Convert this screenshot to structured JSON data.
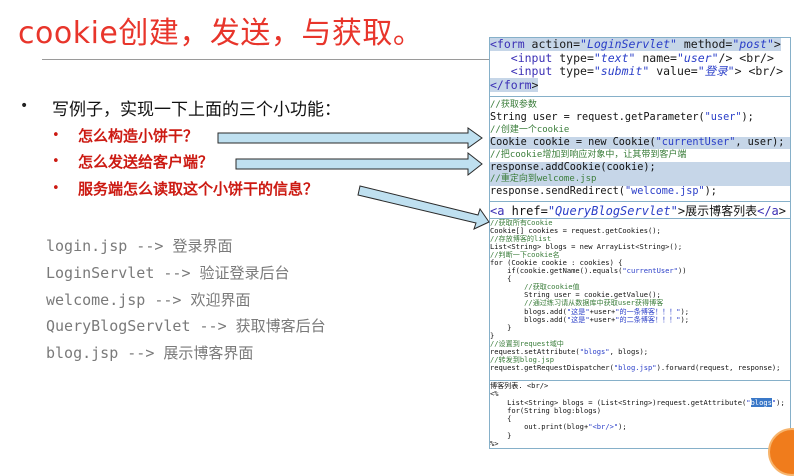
{
  "title": "cookie创建，发送，与获取。",
  "bullet": {
    "main": "写例子，实现一下上面的三个小功能：",
    "items": [
      "怎么构造小饼干？",
      "怎么发送给客户端？",
      "服务端怎么读取这个小饼干的信息？"
    ]
  },
  "pages": [
    {
      "file": "login.jsp -->",
      "desc": "登录界面"
    },
    {
      "file": "LoginServlet -->",
      "desc": "验证登录后台"
    },
    {
      "file": "welcome.jsp -->",
      "desc": "欢迎界面"
    },
    {
      "file": "QueryBlogServlet -->",
      "desc": "获取博客后台"
    },
    {
      "file": "blog.jsp -->",
      "desc": "展示博客界面"
    }
  ],
  "code": {
    "form": [
      "<form action=\"LoginServlet\" method=\"post\">",
      "   <input type=\"text\" name=\"user\"/> <br/>",
      "   <input type=\"submit\" value=\"登录\"> <br/>",
      "</form>"
    ],
    "servlet": [
      "//获取参数",
      "String user = request.getParameter(\"user\");",
      "//创建一个cookie",
      "Cookie cookie = new Cookie(\"currentUser\", user);",
      "//把cookie增加到响应对象中，让其带到客户端",
      "response.addCookie(cookie);",
      "//重定向到welcome.jsp",
      "response.sendRedirect(\"welcome.jsp\");"
    ],
    "link": "<a href=\"QueryBlogServlet\">展示博客列表</a>",
    "query": [
      "//获取所有Cookie",
      "Cookie[] cookies = request.getCookies();",
      "//存放博客的list",
      "List<String> blogs = new ArrayList<String>();",
      "//判断一下cookie名",
      "for (Cookie cookie : cookies) {",
      "    if(cookie.getName().equals(\"currentUser\"))",
      "    {",
      "        //获取cookie值",
      "        String user = cookie.getValue();",
      "        //通过练习请从数据库中获取user获得博客",
      "        blogs.add(\"这是\"+user+\"的一条博客！！！\");",
      "        blogs.add(\"这是\"+user+\"的二条博客！！！\");",
      "    }",
      "}",
      "//设置到request域中",
      "request.setAttribute(\"blogs\", blogs);",
      "//转发到blog.jsp",
      "request.getRequestDispatcher(\"blog.jsp\").forward(request, response);"
    ],
    "jsp": [
      "博客列表. <br/>",
      "<%",
      "    List<String> blogs = (List<String>)request.getAttribute(\"blogs\");",
      "    for(String blog:blogs)",
      "    {",
      "        out.print(blog+\"<br/>\");",
      "    }",
      "%>"
    ]
  },
  "colors": {
    "title": "#e8352b",
    "sub_items": "#cc1a12",
    "panel_border": "#86b0c9",
    "arrow_fill": "#bfe0f0"
  }
}
